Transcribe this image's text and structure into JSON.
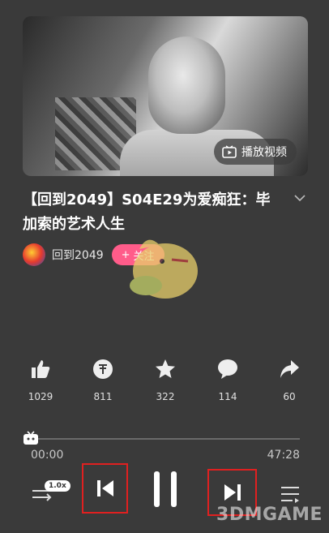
{
  "cover": {
    "play_label": "播放视频"
  },
  "title": "【回到2049】S04E29为爱痴狂：毕加索的艺术人生",
  "author": {
    "name": "回到2049",
    "follow_label": "关注"
  },
  "actions": [
    {
      "icon": "thumbs-up-icon",
      "count": "1029"
    },
    {
      "icon": "coin-icon",
      "count": "811"
    },
    {
      "icon": "star-icon",
      "count": "322"
    },
    {
      "icon": "comment-icon",
      "count": "114"
    },
    {
      "icon": "share-icon",
      "count": "60"
    }
  ],
  "player": {
    "current_time": "00:00",
    "total_time": "47:28",
    "progress": 0,
    "speed": "1.0x"
  },
  "watermark": "3DMGAME",
  "colors": {
    "background": "#3a3a3a",
    "follow": "#ff5c8a",
    "highlight": "#e02020"
  }
}
